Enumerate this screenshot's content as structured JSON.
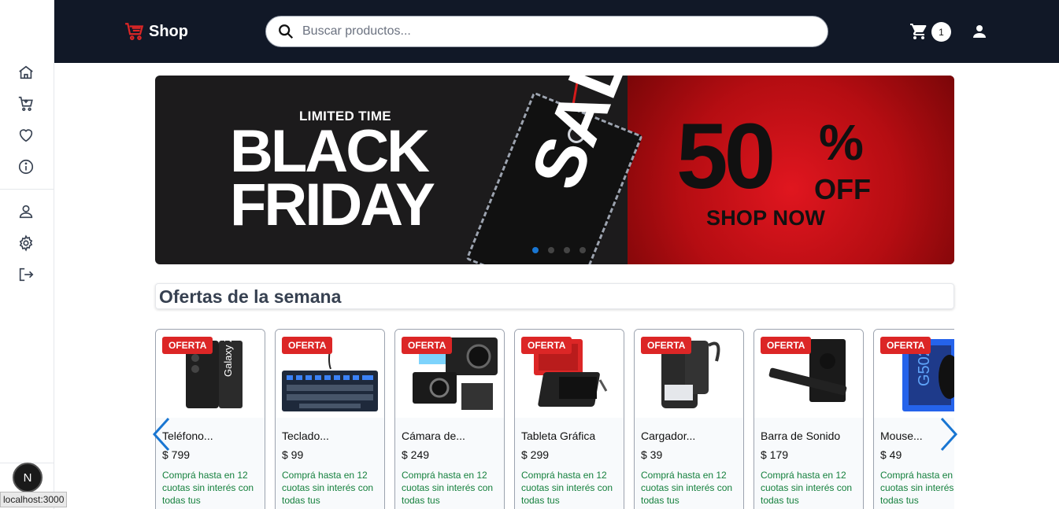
{
  "header": {
    "logo_text": "Shop",
    "search_placeholder": "Buscar productos...",
    "cart_count": "1"
  },
  "sidebar": {
    "items": [
      {
        "icon": "home-icon"
      },
      {
        "icon": "cart-icon"
      },
      {
        "icon": "heart-icon"
      },
      {
        "icon": "info-icon"
      },
      {
        "icon": "user-icon"
      },
      {
        "icon": "gear-icon"
      },
      {
        "icon": "logout-icon"
      }
    ],
    "badge_letter": "N"
  },
  "banner": {
    "small_text": "LIMITED TIME",
    "line1": "BLACK",
    "line2": "FRIDAY",
    "tag_text": "SALE",
    "percent": "50",
    "percent_sign": "%",
    "off_text": "OFF",
    "cta": "SHOP NOW",
    "active_slide": 1,
    "slide_count": 4
  },
  "section": {
    "title": "Ofertas de la semana"
  },
  "products": [
    {
      "badge": "OFERTA",
      "name": "Teléfono...",
      "price": "$ 799",
      "financing": "Comprá hasta en 12 cuotas sin interés con todas tus"
    },
    {
      "badge": "OFERTA",
      "name": "Teclado...",
      "price": "$ 99",
      "financing": "Comprá hasta en 12 cuotas sin interés con todas tus"
    },
    {
      "badge": "OFERTA",
      "name": "Cámara de...",
      "price": "$ 249",
      "financing": "Comprá hasta en 12 cuotas sin interés con todas tus"
    },
    {
      "badge": "OFERTA",
      "name": "Tableta Gráfica",
      "price": "$ 299",
      "financing": "Comprá hasta en 12 cuotas sin interés con todas tus"
    },
    {
      "badge": "OFERTA",
      "name": "Cargador...",
      "price": "$ 39",
      "financing": "Comprá hasta en 12 cuotas sin interés con todas tus"
    },
    {
      "badge": "OFERTA",
      "name": "Barra de Sonido",
      "price": "$ 179",
      "financing": "Comprá hasta en 12 cuotas sin interés con todas tus"
    },
    {
      "badge": "OFERTA",
      "name": "Mouse...",
      "price": "$ 49",
      "financing": "Comprá hasta en 12 cuotas sin interés con todas tus"
    }
  ],
  "status": {
    "url": "localhost:3000"
  },
  "colors": {
    "topbar": "#111827",
    "badge": "#dc2626",
    "financing": "#15803d",
    "accent": "#1976d2"
  }
}
